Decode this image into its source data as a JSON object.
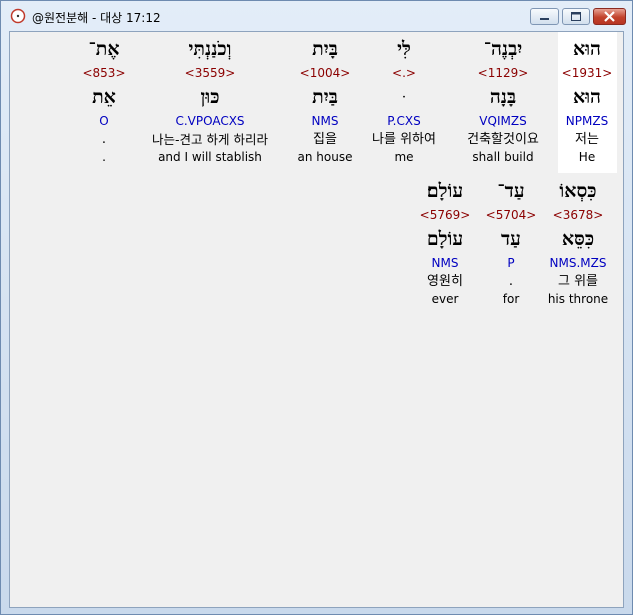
{
  "window": {
    "title": "@원전분해 - 대상 17:12"
  },
  "rows": [
    {
      "words": [
        {
          "surface": "הוּא",
          "strong": "<1931>",
          "lemma": "הוּא",
          "morph": "NPMZS",
          "korean": "저는",
          "english": "He",
          "highlighted": true
        },
        {
          "surface": "יִבְנֶה־",
          "strong": "<1129>",
          "lemma": "בָּנָה",
          "morph": "VQIMZS",
          "korean": "건축할것이요",
          "english": "shall build"
        },
        {
          "surface": "לִּי",
          "strong": "<.>",
          "lemma": "ּ",
          "morph": "P.CXS",
          "korean": "나를 위하여",
          "english": "me"
        },
        {
          "surface": "בָּיִת",
          "strong": "<1004>",
          "lemma": "בַּיִת",
          "morph": "NMS",
          "korean": "집을",
          "english": "an house"
        },
        {
          "surface": "וְכֹנַנְתִּי",
          "strong": "<3559>",
          "lemma": "כּוּן",
          "morph": "C.VPOACXS",
          "korean": "나는-견고 하게 하리라",
          "english": "and I will stablish"
        },
        {
          "surface": "אֶת־",
          "strong": "<853>",
          "lemma": "אֵת",
          "morph": "O",
          "korean": ".",
          "english": "."
        }
      ]
    },
    {
      "words": [
        {
          "surface": "כִּסְאוֹ",
          "strong": "<3678>",
          "lemma": "כִּסֵּא",
          "morph": "NMS.MZS",
          "korean": "그 위를",
          "english": "his throne"
        },
        {
          "surface": "עַד־",
          "strong": "<5704>",
          "lemma": "עַד",
          "morph": "P",
          "korean": ".",
          "english": "for"
        },
        {
          "surface": "עוֹלָם׃",
          "strong": "<5769>",
          "lemma": "עוֹלָם",
          "morph": "NMS",
          "korean": "영원히",
          "english": "ever"
        }
      ]
    }
  ]
}
